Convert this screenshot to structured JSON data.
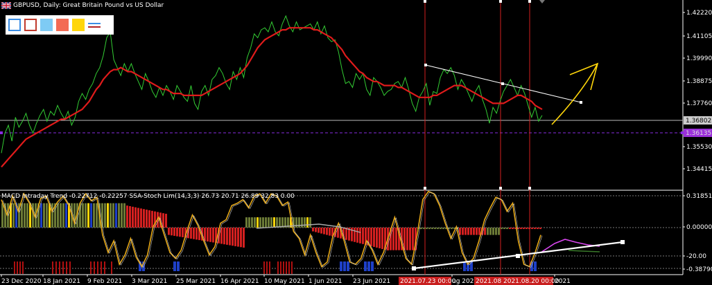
{
  "header": {
    "symbol_title": "GBPUSD, Daily:  Great Britain Pound vs US Dollar",
    "flag_icon": "uk-flag-icon"
  },
  "toolbar": {
    "buttons": [
      {
        "name": "frame-blue-button",
        "color": "#3a8ee6"
      },
      {
        "name": "frame-red-button",
        "color": "#c0392b"
      },
      {
        "name": "fill-lightblue-button",
        "color": "#7ecbf4"
      },
      {
        "name": "fill-salmon-button",
        "color": "#f36b54"
      },
      {
        "name": "fill-yellow-button",
        "color": "#ffd60a"
      },
      {
        "name": "line-style-button",
        "color": "#b22222"
      }
    ]
  },
  "price_axis": {
    "ticks": [
      "1.42220",
      "1.41105",
      "1.39990",
      "1.38875",
      "1.37760",
      "1.35530",
      "1.34415"
    ],
    "current_price": "1.36802",
    "line_price": "1.36135",
    "current_price_color": "#cccccc",
    "line_price_color": "#9b30d9"
  },
  "indicator": {
    "title": "MACD Intraday Trend  -0.22712 -0.22257 SSA-Stoch Lim(14,3,3) 26.73 20.71 26.89 32.83 0.00",
    "ticks": [
      "0.31851",
      "0.00000",
      "-20.00",
      "-0.38790"
    ]
  },
  "time_axis": {
    "labels": [
      "23 Dec 2020",
      "18 Jan 2021",
      "9 Feb 2021",
      "3 Mar 2021",
      "25 Mar 2021",
      "16 Apr 2021",
      "10 May 2021",
      "1 Jun 2021",
      "23 Jun 2021",
      "ug 2021",
      "2021"
    ],
    "highlights": [
      "2021.07.23 00:00",
      "2021.08.06 00:00",
      "2021.08.20 00:00"
    ]
  },
  "chart_data": [
    {
      "type": "line",
      "title": "GBPUSD, Daily:  Great Britain Pound vs US Dollar",
      "ylim": [
        1.334,
        1.429
      ],
      "series": [
        {
          "name": "",
          "color": "#33cc33",
          "y": [
            1.352,
            1.362,
            1.366,
            1.358,
            1.37,
            1.365,
            1.368,
            1.372,
            1.366,
            1.362,
            1.367,
            1.371,
            1.374,
            1.368,
            1.373,
            1.371,
            1.376,
            1.372,
            1.369,
            1.373,
            1.366,
            1.37,
            1.378,
            1.382,
            1.379,
            1.384,
            1.387,
            1.392,
            1.395,
            1.401,
            1.41,
            1.413,
            1.399,
            1.395,
            1.391,
            1.397,
            1.393,
            1.397,
            1.392,
            1.388,
            1.384,
            1.392,
            1.388,
            1.383,
            1.38,
            1.385,
            1.381,
            1.386,
            1.383,
            1.379,
            1.386,
            1.383,
            1.38,
            1.378,
            1.386,
            1.377,
            1.374,
            1.383,
            1.386,
            1.381,
            1.389,
            1.391,
            1.395,
            1.392,
            1.387,
            1.384,
            1.393,
            1.389,
            1.395,
            1.39,
            1.4,
            1.405,
            1.412,
            1.41,
            1.414,
            1.415,
            1.413,
            1.418,
            1.413,
            1.411,
            1.417,
            1.421,
            1.416,
            1.413,
            1.418,
            1.414,
            1.415,
            1.416,
            1.417,
            1.414,
            1.418,
            1.412,
            1.416,
            1.41,
            1.408,
            1.409,
            1.403,
            1.394,
            1.387,
            1.388,
            1.385,
            1.392,
            1.389,
            1.392,
            1.384,
            1.381,
            1.39,
            1.388,
            1.385,
            1.381,
            1.383,
            1.384,
            1.387,
            1.388,
            1.385,
            1.39,
            1.384,
            1.377,
            1.373,
            1.38,
            1.383,
            1.387,
            1.376,
            1.383,
            1.382,
            1.39,
            1.394,
            1.392,
            1.395,
            1.391,
            1.384,
            1.389,
            1.386,
            1.382,
            1.378,
            1.383,
            1.386,
            1.379,
            1.374,
            1.367,
            1.375,
            1.372,
            1.378,
            1.383,
            1.386,
            1.389,
            1.385,
            1.381,
            1.386,
            1.382,
            1.376,
            1.37,
            1.375,
            1.368,
            1.371
          ]
        },
        {
          "name": "",
          "color": "#e01b1b",
          "y": [
            1.345,
            1.347,
            1.349,
            1.351,
            1.353,
            1.355,
            1.357,
            1.359,
            1.36,
            1.361,
            1.362,
            1.363,
            1.364,
            1.365,
            1.366,
            1.367,
            1.368,
            1.369,
            1.369,
            1.37,
            1.371,
            1.372,
            1.373,
            1.374,
            1.376,
            1.378,
            1.381,
            1.384,
            1.386,
            1.389,
            1.391,
            1.393,
            1.394,
            1.394,
            1.395,
            1.394,
            1.393,
            1.393,
            1.392,
            1.391,
            1.39,
            1.389,
            1.388,
            1.387,
            1.386,
            1.385,
            1.384,
            1.384,
            1.383,
            1.382,
            1.382,
            1.382,
            1.381,
            1.381,
            1.381,
            1.381,
            1.381,
            1.381,
            1.382,
            1.383,
            1.384,
            1.385,
            1.386,
            1.387,
            1.388,
            1.389,
            1.39,
            1.391,
            1.392,
            1.394,
            1.396,
            1.399,
            1.402,
            1.405,
            1.407,
            1.409,
            1.41,
            1.411,
            1.412,
            1.413,
            1.414,
            1.414,
            1.415,
            1.415,
            1.415,
            1.415,
            1.415,
            1.415,
            1.415,
            1.414,
            1.414,
            1.413,
            1.412,
            1.411,
            1.41,
            1.408,
            1.406,
            1.404,
            1.401,
            1.399,
            1.397,
            1.395,
            1.393,
            1.392,
            1.39,
            1.389,
            1.388,
            1.388,
            1.387,
            1.386,
            1.386,
            1.386,
            1.386,
            1.385,
            1.385,
            1.384,
            1.383,
            1.382,
            1.381,
            1.38,
            1.38,
            1.38,
            1.38,
            1.381,
            1.381,
            1.382,
            1.383,
            1.384,
            1.385,
            1.386,
            1.386,
            1.386,
            1.385,
            1.384,
            1.383,
            1.382,
            1.381,
            1.38,
            1.379,
            1.378,
            1.377,
            1.377,
            1.377,
            1.377,
            1.378,
            1.379,
            1.38,
            1.381,
            1.381,
            1.38,
            1.379,
            1.378,
            1.376,
            1.375,
            1.374
          ]
        }
      ]
    },
    {
      "type": "bar",
      "title": "MACD Intraday Trend  -0.22712 -0.22257 SSA-Stoch Lim(14,3,3) 26.73 20.71 26.89 32.83 0.00",
      "ylim": [
        -0.3879,
        0.3185
      ],
      "series": [
        {
          "name": "",
          "color": "#e6a817",
          "y": [
            0.25,
            0.12,
            0.28,
            0.15,
            0.3,
            0.22,
            0.1,
            0.26,
            0.28,
            0.15,
            0.23,
            0.28,
            0.2,
            0.05,
            0.22,
            0.3,
            0.24,
            0.27,
            -0.05,
            -0.2,
            -0.1,
            -0.3,
            -0.22,
            -0.08,
            -0.24,
            -0.32,
            -0.22,
            0.02,
            0.1,
            -0.05,
            -0.2,
            -0.25,
            -0.18,
            -0.02,
            0.12,
            0.03,
            -0.1,
            -0.22,
            -0.15,
            0.05,
            0.08,
            0.2,
            0.22,
            0.25,
            0.18,
            0.28,
            0.3,
            0.22,
            0.3,
            0.28,
            0.2,
            0.23,
            -0.02,
            -0.08,
            -0.22,
            -0.05,
            -0.2,
            -0.32,
            -0.28,
            -0.06,
            0.05,
            -0.1,
            -0.28,
            -0.3,
            -0.25,
            -0.1,
            -0.18,
            -0.3,
            -0.2,
            -0.05,
            0.1,
            -0.08,
            -0.25,
            -0.3,
            -0.05,
            0.25,
            0.32,
            0.3,
            0.2,
            0.05,
            -0.08,
            0.02,
            -0.2,
            -0.3,
            -0.25,
            -0.1,
            0.08,
            0.18,
            0.27,
            0.25,
            0.15,
            0.22,
            -0.1,
            -0.3,
            -0.32,
            -0.2,
            -0.05
          ]
        }
      ]
    }
  ]
}
